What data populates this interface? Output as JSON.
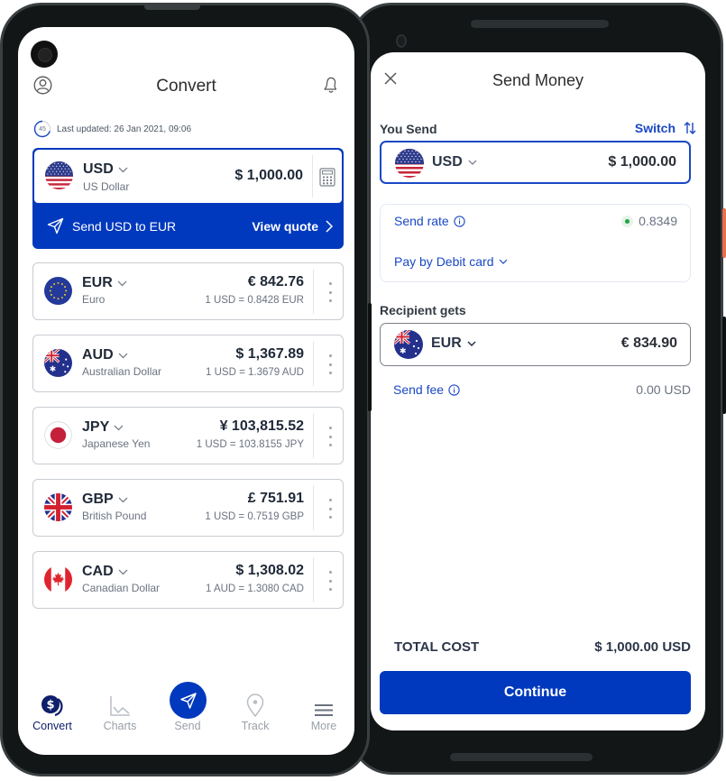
{
  "convert_screen": {
    "title": "Convert",
    "last_updated": "Last updated: 26 Jan 2021, 09:06",
    "refresh_seconds": "45",
    "base": {
      "code": "USD",
      "name": "US Dollar",
      "amount": "$ 1,000.00",
      "flag": "us-flag"
    },
    "send_banner": {
      "label": "Send USD to EUR",
      "action": "View quote"
    },
    "currencies": [
      {
        "code": "EUR",
        "name": "Euro",
        "amount": "€ 842.76",
        "rate": "1 USD = 0.8428 EUR",
        "flag": "eu-flag"
      },
      {
        "code": "AUD",
        "name": "Australian Dollar",
        "amount": "$ 1,367.89",
        "rate": "1 USD = 1.3679 AUD",
        "flag": "au-flag"
      },
      {
        "code": "JPY",
        "name": "Japanese Yen",
        "amount": "¥ 103,815.52",
        "rate": "1 USD = 103.8155 JPY",
        "flag": "jp-flag"
      },
      {
        "code": "GBP",
        "name": "British Pound",
        "amount": "£ 751.91",
        "rate": "1 USD = 0.7519 GBP",
        "flag": "gb-flag"
      },
      {
        "code": "CAD",
        "name": "Canadian Dollar",
        "amount": "$ 1,308.02",
        "rate": "1 AUD = 1.3080 CAD",
        "flag": "ca-flag"
      }
    ],
    "nav": [
      {
        "label": "Convert",
        "icon": "dollar-coins-icon",
        "active": true
      },
      {
        "label": "Charts",
        "icon": "line-chart-icon",
        "active": false
      },
      {
        "label": "Send",
        "icon": "paper-plane-icon",
        "active": false
      },
      {
        "label": "Track",
        "icon": "location-pin-icon",
        "active": false
      },
      {
        "label": "More",
        "icon": "menu-icon",
        "active": false
      }
    ]
  },
  "send_screen": {
    "title": "Send Money",
    "you_send_label": "You Send",
    "switch_label": "Switch",
    "send_currency": "USD",
    "send_amount": "$ 1,000.00",
    "send_rate_label": "Send rate",
    "send_rate_value": "0.8349",
    "pay_method": "Pay by Debit card",
    "recipient_label": "Recipient gets",
    "recipient_currency": "EUR",
    "recipient_amount": "€ 834.90",
    "send_fee_label": "Send fee",
    "send_fee_value": "0.00 USD",
    "total_label": "TOTAL COST",
    "total_value": "$ 1,000.00 USD",
    "continue_label": "Continue"
  },
  "colors": {
    "brand_blue": "#0039be",
    "link_blue": "#1a48c4",
    "nav_active": "#0e1e6b",
    "rate_live_green": "#1fa53b"
  }
}
